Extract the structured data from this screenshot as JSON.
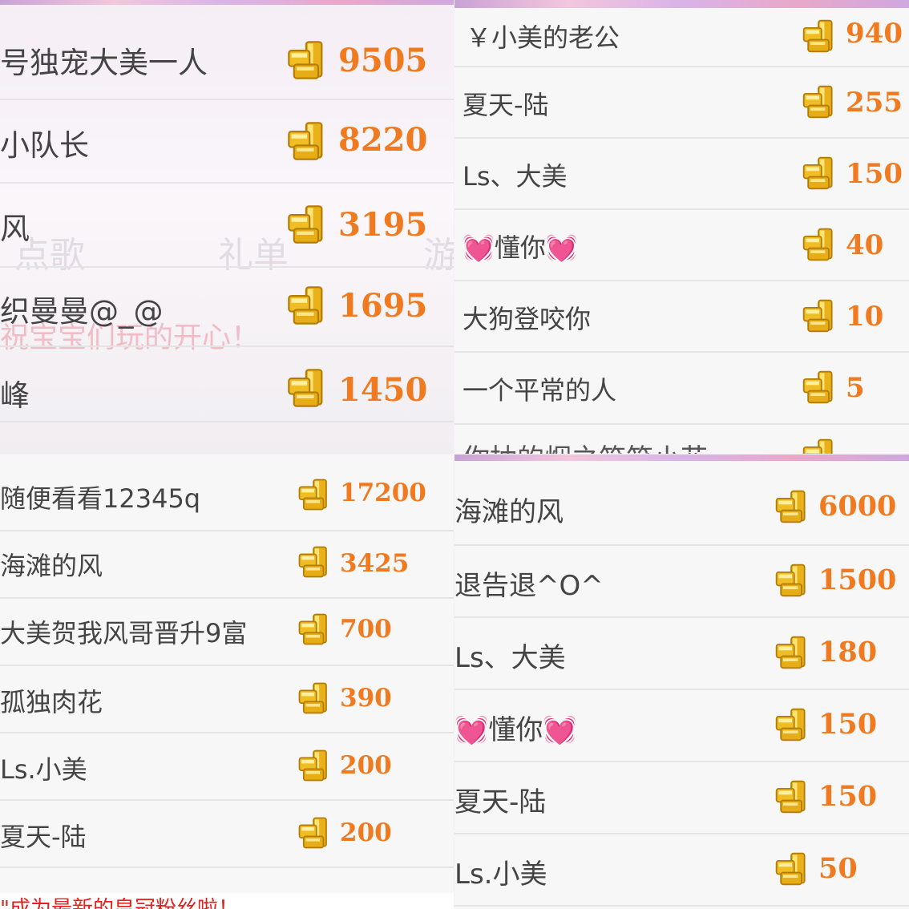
{
  "colors": {
    "amount": "#f07a1f",
    "name": "#444444",
    "divider": "#e4e4e4",
    "banner_text": "#e0211e"
  },
  "icon": "gold-coin-stack-icon",
  "panel_tl": {
    "rows": [
      {
        "name": "号独宠大美一人",
        "amount": "9505"
      },
      {
        "name": "小队长",
        "amount": "8220"
      },
      {
        "name": "风",
        "amount": "3195"
      },
      {
        "name": "织曼曼@_@",
        "amount": "1695"
      },
      {
        "name": "峰",
        "amount": "1450"
      }
    ],
    "bg_tabs": [
      "点歌",
      "礼单",
      "游"
    ],
    "bg_message": "祝宝宝们玩的开心！"
  },
  "panel_tr": {
    "rows": [
      {
        "name": "￥小美的老公",
        "amount": "940"
      },
      {
        "name": "夏天-陆",
        "amount": "255"
      },
      {
        "name": "Ls、大美",
        "amount": "150"
      },
      {
        "name": "💓懂你💓",
        "amount": "40"
      },
      {
        "name": "大狗登咬你",
        "amount": "10"
      },
      {
        "name": "一个平常的人",
        "amount": "5"
      }
    ],
    "partial_row": "你抽的烟之笑笑小花"
  },
  "panel_bl": {
    "rows": [
      {
        "name": "随便看看12345q",
        "amount": "17200"
      },
      {
        "name": "海滩的风",
        "amount": "3425"
      },
      {
        "name": "大美贺我风哥晋升9富",
        "amount": "700"
      },
      {
        "name": "孤独肉花",
        "amount": "390"
      },
      {
        "name": "Ls.小美",
        "amount": "200"
      },
      {
        "name": "夏天-陆",
        "amount": "200"
      }
    ],
    "banner": "\"成为最新的皇冠粉丝啦！"
  },
  "panel_br": {
    "rows": [
      {
        "name": "海滩的风",
        "amount": "6000"
      },
      {
        "name": "退告退^O^",
        "amount": "1500"
      },
      {
        "name": "Ls、大美",
        "amount": "180"
      },
      {
        "name": "💓懂你💓",
        "amount": "150"
      },
      {
        "name": "夏天-陆",
        "amount": "150"
      },
      {
        "name": "Ls.小美",
        "amount": "50"
      }
    ]
  }
}
